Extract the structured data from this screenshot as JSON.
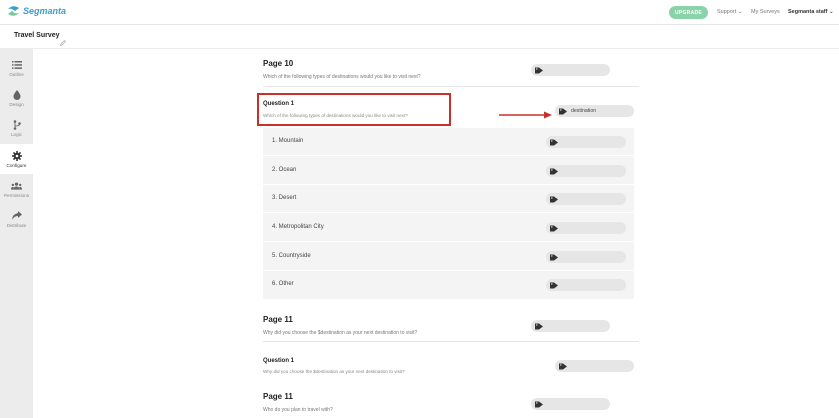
{
  "app": {
    "name": "Segmanta"
  },
  "topbar": {
    "upgrade_label": "UPGRADE",
    "support_label": "Support",
    "my_surveys_label": "My Surveys",
    "user_label": "Segmanta staff"
  },
  "survey": {
    "title": "Travel Survey"
  },
  "sidebar": {
    "items": [
      {
        "label": "Outline",
        "icon": "list-icon"
      },
      {
        "label": "Design",
        "icon": "droplet-icon"
      },
      {
        "label": "Logic",
        "icon": "branch-icon"
      },
      {
        "label": "Configure",
        "icon": "gear-icon",
        "active": true
      },
      {
        "label": "Permissions",
        "icon": "users-icon"
      },
      {
        "label": "Distribute",
        "icon": "share-icon"
      }
    ]
  },
  "content": {
    "page10": {
      "title": "Page 10",
      "description": "Which of the following types of destinations would you like to visit next?"
    },
    "q1": {
      "title": "Question 1",
      "description": "Which of the following types of destinations would you like to visit next?",
      "tag_value": "destination"
    },
    "options": [
      {
        "label": "1. Mountain"
      },
      {
        "label": "2. Ocean"
      },
      {
        "label": "3. Desert"
      },
      {
        "label": "4. Metropolitan City"
      },
      {
        "label": "5. Countryside"
      },
      {
        "label": "6. Other"
      }
    ],
    "page11a": {
      "title": "Page 11",
      "description": "Why did you choose the $destination as your next destination to visit?"
    },
    "q1b": {
      "title": "Question 1",
      "description": "Why did you choose the $destination as your next destination to visit?"
    },
    "page11b": {
      "title": "Page 11",
      "description": "Who do you plan to travel with?"
    }
  },
  "colors": {
    "accent_green": "#8ad3a8",
    "logo_blue": "#3aa0c8",
    "highlight_red": "#c9302c"
  }
}
